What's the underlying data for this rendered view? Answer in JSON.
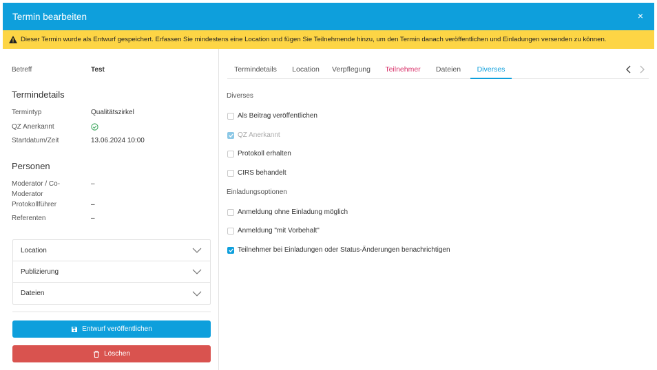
{
  "dialog": {
    "title": "Termin bearbeiten",
    "close_label": "×"
  },
  "warning": {
    "text": "Dieser Termin wurde als Entwurf gespeichert. Erfassen Sie mindestens eine Location und fügen Sie Teilnehmende hinzu, um den Termin danach veröffentlichen und Einladungen versenden zu können."
  },
  "left": {
    "betreff_label": "Betreff",
    "betreff_value": "Test",
    "termindetails_title": "Termindetails",
    "termintyp_label": "Termintyp",
    "termintyp_value": "Qualitätszirkel",
    "qz_label": "QZ Anerkannt",
    "start_label": "Startdatum/Zeit",
    "start_value": "13.06.2024 10:00",
    "personen_title": "Personen",
    "moderator_label_1": "Moderator / Co-",
    "moderator_label_2": "Moderator",
    "moderator_value": "–",
    "protokoll_label": "Protokollführer",
    "protokoll_value": "–",
    "referenten_label": "Referenten",
    "referenten_value": "–",
    "accordion": [
      "Location",
      "Publizierung",
      "Dateien"
    ],
    "publish_button": "Entwurf veröffentlichen",
    "delete_button": "Löschen"
  },
  "tabs": [
    "Termindetails",
    "Location",
    "Verpflegung",
    "Teilnehmer",
    "Dateien",
    "Diverses"
  ],
  "active_tab": "Diverses",
  "diverses": {
    "section_title": "Diverses",
    "options": [
      {
        "label": "Als Beitrag veröffentlichen",
        "checked": false,
        "disabled": false
      },
      {
        "label": "QZ Anerkannt",
        "checked": true,
        "disabled": true
      },
      {
        "label": "Protokoll erhalten",
        "checked": false,
        "disabled": false
      },
      {
        "label": "CIRS behandelt",
        "checked": false,
        "disabled": false
      }
    ],
    "invite_title": "Einladungsoptionen",
    "invite_options": [
      {
        "label": "Anmeldung ohne Einladung möglich",
        "checked": false
      },
      {
        "label": "Anmeldung \"mit Vorbehalt\"",
        "checked": false
      },
      {
        "label": "Teilnehmer bei Einladungen oder Status-Änderungen benachrichtigen",
        "checked": true
      }
    ]
  },
  "colors": {
    "primary": "#0e9fdc",
    "warning": "#fdd545",
    "danger": "#d9534f",
    "tab_red": "#d9336b",
    "success": "#3ba55c"
  }
}
